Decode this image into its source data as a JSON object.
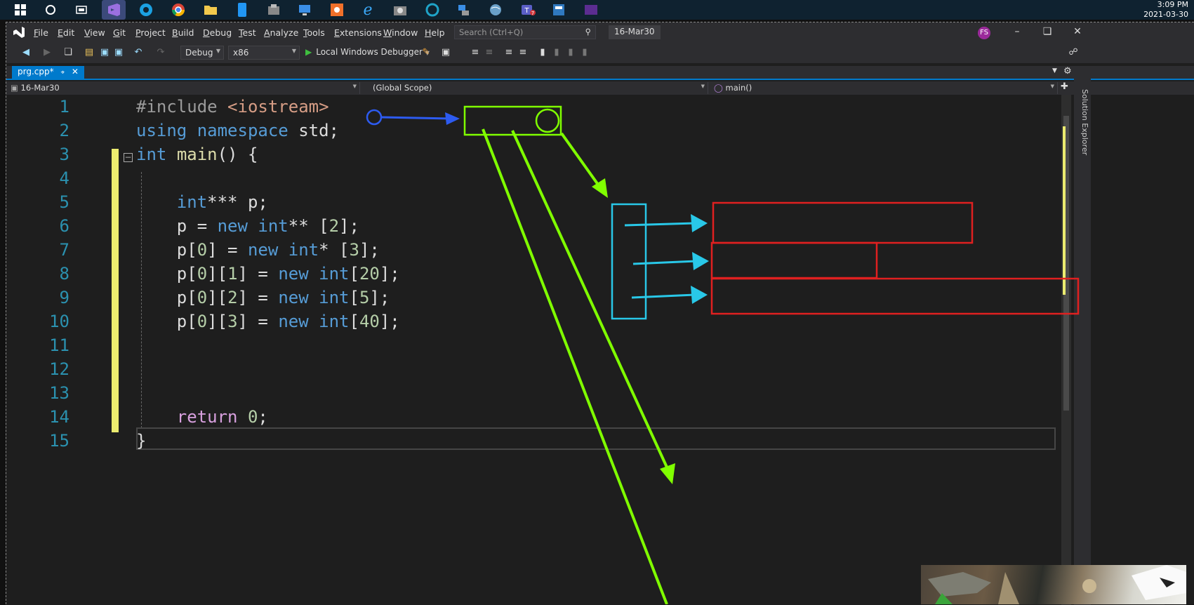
{
  "taskbar": {
    "time": "3:09 PM",
    "date": "2021-03-30",
    "icons": [
      "windows-start-icon",
      "cortana-icon",
      "task-view-icon",
      "visual-studio-icon",
      "edge-icon",
      "chrome-icon",
      "file-explorer-icon",
      "phone-icon",
      "camera-icon",
      "remote-desktop-icon",
      "snipping-icon",
      "ie-icon",
      "screenshot-icon",
      "circle-app-icon",
      "network-icon",
      "globe-icon",
      "teams-icon",
      "app-icon",
      "purple-app-icon"
    ]
  },
  "menu": {
    "items": [
      "File",
      "Edit",
      "View",
      "Git",
      "Project",
      "Build",
      "Debug",
      "Test",
      "Analyze",
      "Tools",
      "Extensions",
      "Window",
      "Help"
    ],
    "search_placeholder": "Search (Ctrl+Q)",
    "solution_name": "16-Mar30",
    "avatar": "FS"
  },
  "toolbar": {
    "config": "Debug",
    "platform": "x86",
    "debugger": "Local Windows Debugger"
  },
  "tabs": [
    {
      "label": "prg.cpp*",
      "active": true
    }
  ],
  "navbar": {
    "project": "16-Mar30",
    "scope": "(Global Scope)",
    "member": "main()"
  },
  "side_panel": {
    "label": "Solution Explorer"
  },
  "editor": {
    "lines": [
      {
        "n": "1",
        "text": "#include <iostream>"
      },
      {
        "n": "2",
        "text": "using namespace std;"
      },
      {
        "n": "3",
        "text": "int main() {"
      },
      {
        "n": "4",
        "text": ""
      },
      {
        "n": "5",
        "text": "    int*** p;"
      },
      {
        "n": "6",
        "text": "    p = new int** [2];"
      },
      {
        "n": "7",
        "text": "    p[0] = new int* [3];"
      },
      {
        "n": "8",
        "text": "    p[0][1] = new int[20];"
      },
      {
        "n": "9",
        "text": "    p[0][2] = new int[5];"
      },
      {
        "n": "10",
        "text": "    p[0][3] = new int[40];"
      },
      {
        "n": "11",
        "text": ""
      },
      {
        "n": "12",
        "text": ""
      },
      {
        "n": "13",
        "text": ""
      },
      {
        "n": "14",
        "text": "    return 0;"
      },
      {
        "n": "15",
        "text": "}"
      }
    ]
  },
  "colors": {
    "keyword": "#569cd6",
    "preprocessor": "#9b9b9b",
    "include": "#d69d85",
    "function": "#dcdcaa",
    "return": "#d8a0df",
    "number": "#b5cea8",
    "line_number": "#2b91af",
    "accent": "#007acc",
    "annotation_green": "#80ff00",
    "annotation_cyan": "#29c8e8",
    "annotation_red": "#e02020",
    "annotation_blue": "#2d5bf0"
  }
}
